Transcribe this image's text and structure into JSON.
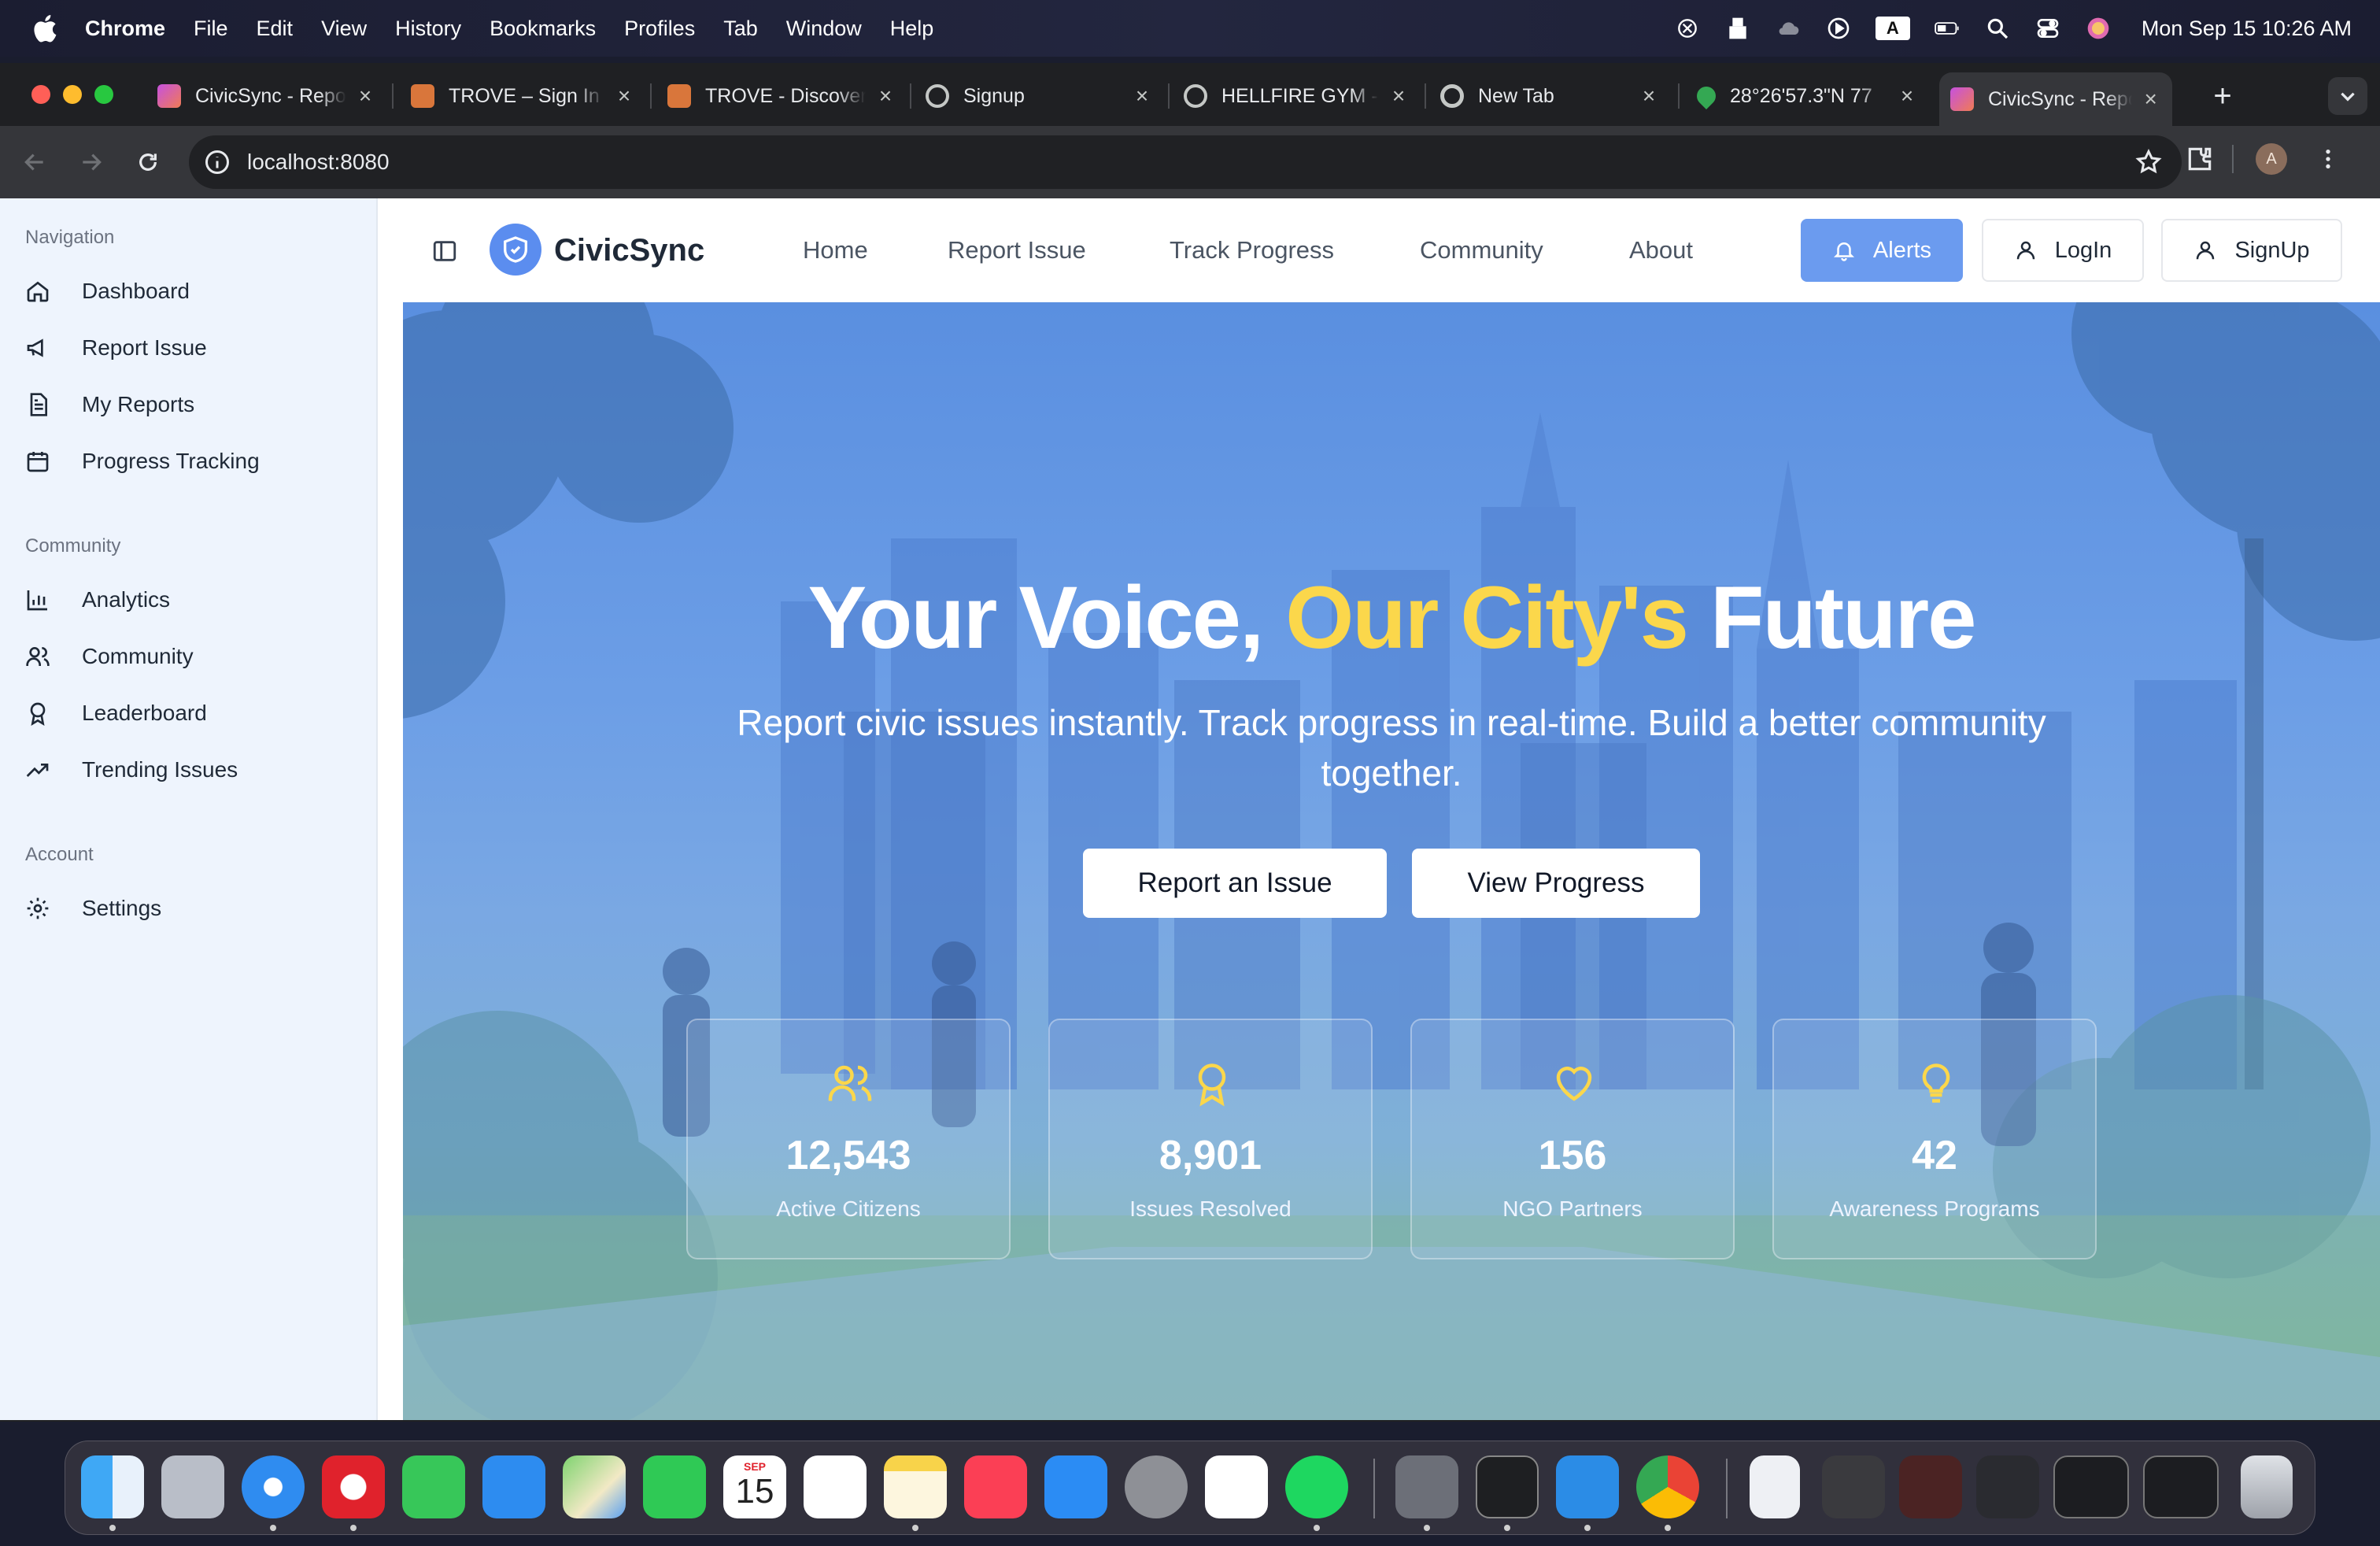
{
  "menubar": {
    "app": "Chrome",
    "items": [
      "File",
      "Edit",
      "View",
      "History",
      "Bookmarks",
      "Profiles",
      "Tab",
      "Window",
      "Help"
    ],
    "input_source": "A",
    "clock": "Mon Sep 15  10:26 AM"
  },
  "tabs": [
    {
      "title": "CivicSync - Report",
      "favicon": "civicsync-icon"
    },
    {
      "title": "TROVE – Sign In",
      "favicon": "trove-icon"
    },
    {
      "title": "TROVE - Discover",
      "favicon": "trove-icon"
    },
    {
      "title": "Signup",
      "favicon": "globe-icon"
    },
    {
      "title": "HELLFIRE GYM - ",
      "favicon": "globe-icon"
    },
    {
      "title": "New Tab",
      "favicon": "chrome-icon"
    },
    {
      "title": "28°26'57.3\"N 77",
      "favicon": "maps-pin-icon"
    },
    {
      "title": "CivicSync - Report",
      "favicon": "civicsync-icon"
    }
  ],
  "address_bar": {
    "url": "localhost:8080"
  },
  "profile_initial": "A",
  "sidebar": {
    "groups": [
      {
        "label": "Navigation",
        "items": [
          {
            "label": "Dashboard",
            "icon": "home-icon"
          },
          {
            "label": "Report Issue",
            "icon": "megaphone-icon"
          },
          {
            "label": "My Reports",
            "icon": "document-icon"
          },
          {
            "label": "Progress Tracking",
            "icon": "calendar-icon"
          }
        ]
      },
      {
        "label": "Community",
        "items": [
          {
            "label": "Analytics",
            "icon": "bar-chart-icon"
          },
          {
            "label": "Community",
            "icon": "users-icon"
          },
          {
            "label": "Leaderboard",
            "icon": "award-icon"
          },
          {
            "label": "Trending Issues",
            "icon": "trending-up-icon"
          }
        ]
      },
      {
        "label": "Account",
        "items": [
          {
            "label": "Settings",
            "icon": "gear-icon"
          }
        ]
      }
    ]
  },
  "header": {
    "brand": "CivicSync",
    "nav": [
      "Home",
      "Report Issue",
      "Track Progress",
      "Community",
      "About"
    ],
    "alerts_label": "Alerts",
    "login_label": "LogIn",
    "signup_label": "SignUp",
    "accent": "#6b9bef"
  },
  "hero": {
    "headline_part1": "Your Voice, ",
    "headline_highlight": "Our City's",
    "headline_part2": " Future",
    "highlight_color": "#fbd74b",
    "subtitle": "Report civic issues instantly. Track progress in real-time. Build a better community together.",
    "cta_primary": "Report an Issue",
    "cta_secondary": "View Progress",
    "stats": [
      {
        "value": "12,543",
        "label": "Active Citizens",
        "icon": "users-icon"
      },
      {
        "value": "8,901",
        "label": "Issues Resolved",
        "icon": "award-icon"
      },
      {
        "value": "156",
        "label": "NGO Partners",
        "icon": "heart-icon"
      },
      {
        "value": "42",
        "label": "Awareness Programs",
        "icon": "lightbulb-icon"
      }
    ]
  },
  "dock": {
    "calendar_month": "SEP",
    "calendar_day": "15"
  }
}
